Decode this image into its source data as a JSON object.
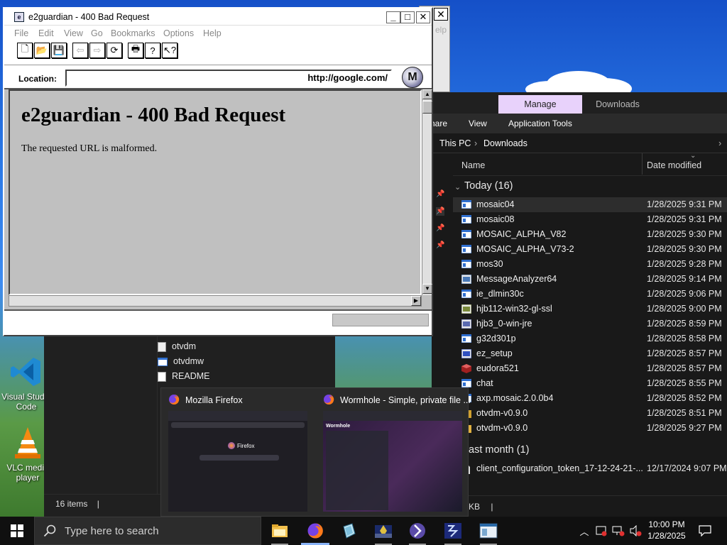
{
  "desktop": {
    "icons": [
      {
        "label": "Visual Studio Code"
      },
      {
        "label": "VLC media player"
      }
    ]
  },
  "mosaic": {
    "title": "e2guardian - 400 Bad Request",
    "menu": [
      "File",
      "Edit",
      "View",
      "Go",
      "Bookmarks",
      "Options",
      "Help"
    ],
    "toolbar_icons": [
      "new-document-icon",
      "open-folder-icon",
      "save-icon",
      "back-arrow-icon",
      "forward-arrow-icon",
      "reload-icon",
      "print-icon",
      "help-icon",
      "context-help-icon"
    ],
    "location_label": "Location:",
    "location_value": "http://google.com/",
    "logo_letter": "M",
    "heading": "e2guardian - 400 Bad Request",
    "body_text": "The requested URL is malformed.",
    "behind_fragment": "elp"
  },
  "explorer": {
    "tabs": {
      "manage": "Manage",
      "downloads": "Downloads"
    },
    "ribbon": {
      "share": "hare",
      "view": "View",
      "app_tools": "Application Tools"
    },
    "breadcrumb": {
      "root": "This PC",
      "sep": "›",
      "current": "Downloads"
    },
    "columns": {
      "name": "Name",
      "date": "Date modified"
    },
    "group_today": "Today (16)",
    "group_last_month": "ast month (1)",
    "files_today": [
      {
        "name": "mosaic04",
        "date": "1/28/2025 9:31 PM",
        "icon": "exe",
        "color": "#2f6fd0"
      },
      {
        "name": "mosaic08",
        "date": "1/28/2025 9:31 PM",
        "icon": "exe",
        "color": "#2f6fd0"
      },
      {
        "name": "MOSAIC_ALPHA_V82",
        "date": "1/28/2025 9:30 PM",
        "icon": "exe",
        "color": "#2f6fd0"
      },
      {
        "name": "MOSAIC_ALPHA_V73-2",
        "date": "1/28/2025 9:30 PM",
        "icon": "exe",
        "color": "#2f6fd0"
      },
      {
        "name": "mos30",
        "date": "1/28/2025 9:28 PM",
        "icon": "exe",
        "color": "#2f6fd0"
      },
      {
        "name": "MessageAnalyzer64",
        "date": "1/28/2025 9:14 PM",
        "icon": "installer",
        "color": "#4a7ab8"
      },
      {
        "name": "ie_dlmin30c",
        "date": "1/28/2025 9:06 PM",
        "icon": "exe",
        "color": "#2f6fd0"
      },
      {
        "name": "hjb112-win32-gl-ssl",
        "date": "1/28/2025 9:00 PM",
        "icon": "installer",
        "color": "#7a8a3a"
      },
      {
        "name": "hjb3_0-win-jre",
        "date": "1/28/2025 8:59 PM",
        "icon": "installer",
        "color": "#5a6ab0"
      },
      {
        "name": "g32d301p",
        "date": "1/28/2025 8:58 PM",
        "icon": "exe",
        "color": "#2f6fd0"
      },
      {
        "name": "ez_setup",
        "date": "1/28/2025 8:57 PM",
        "icon": "installer",
        "color": "#3050c0"
      },
      {
        "name": "eudora521",
        "date": "1/28/2025 8:57 PM",
        "icon": "box",
        "color": "#a02020"
      },
      {
        "name": "chat",
        "date": "1/28/2025 8:55 PM",
        "icon": "exe",
        "color": "#2f6fd0"
      },
      {
        "name": "axp.mosaic.2.0.0b4",
        "date": "1/28/2025 8:52 PM",
        "icon": "exe",
        "color": "#2f6fd0"
      },
      {
        "name": "otvdm-v0.9.0",
        "date": "1/28/2025 8:51 PM",
        "icon": "zip",
        "color": "#d0a030"
      },
      {
        "name": "otvdm-v0.9.0",
        "date": "1/28/2025 9:27 PM",
        "icon": "folder",
        "color": "#e0b040"
      }
    ],
    "files_last_month": [
      {
        "name": "client_configuration_token_17-12-24-21-...",
        "date": "12/17/2024 9:07 PM",
        "icon": "file",
        "color": "#dddddd"
      }
    ],
    "status_fragment": "KB"
  },
  "bg_explorer": {
    "files": [
      {
        "name": "otvdm",
        "icon": "file"
      },
      {
        "name": "otvdmw",
        "icon": "exe"
      },
      {
        "name": "README",
        "icon": "file"
      }
    ],
    "status": "16 items"
  },
  "thumbnails": [
    {
      "title": "Mozilla Firefox",
      "preview_text": "Firefox"
    },
    {
      "title": "Wormhole - Simple, private file ...",
      "preview_text": "Wormhole"
    }
  ],
  "taskbar": {
    "search_placeholder": "Type here to search",
    "time": "10:00 PM",
    "date": "1/28/2025",
    "apps": [
      "file-explorer-icon",
      "firefox-icon",
      "app-icon-1",
      "app-icon-2",
      "app-icon-3",
      "app-icon-4",
      "app-icon-5"
    ]
  }
}
